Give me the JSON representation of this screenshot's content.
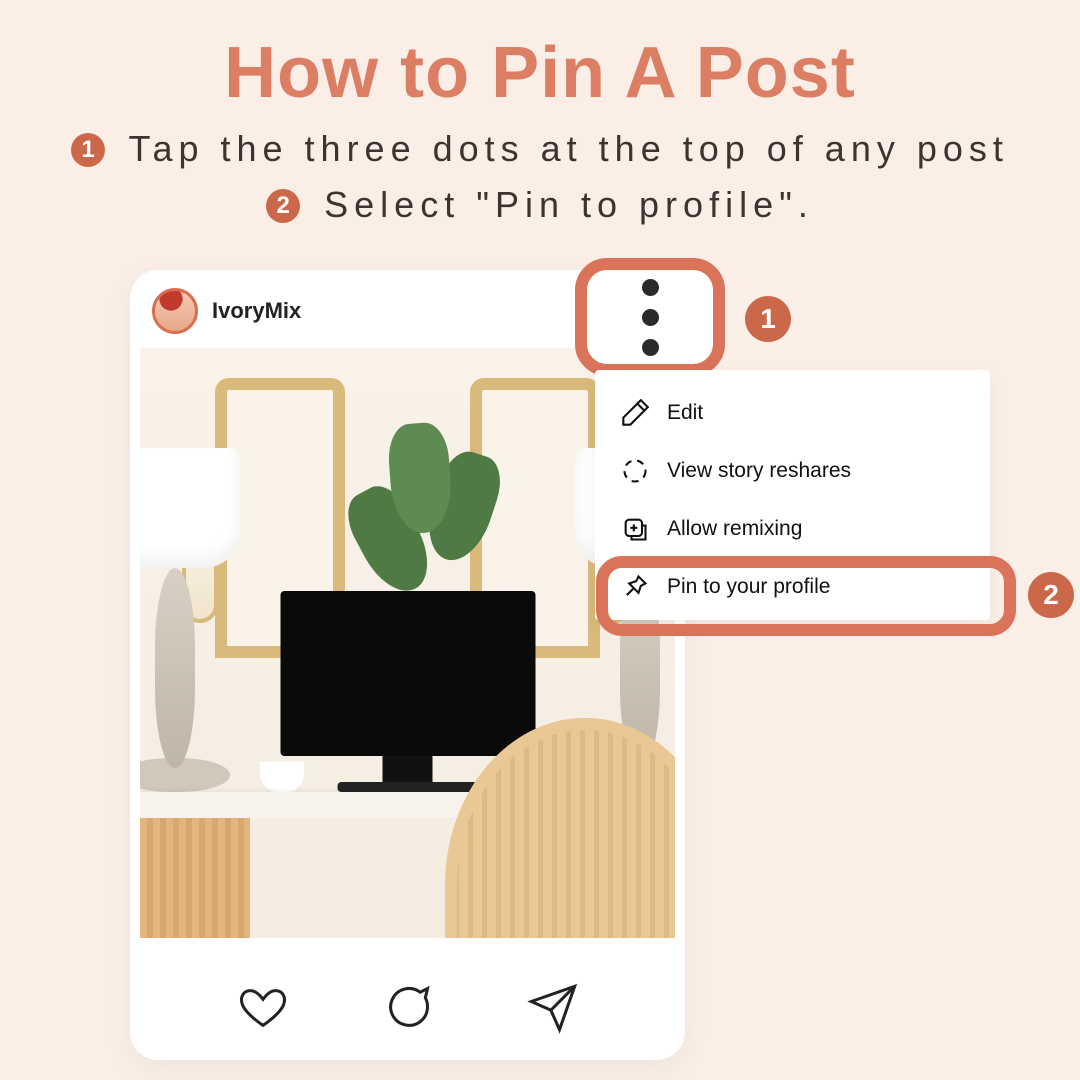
{
  "title": "How to Pin A Post",
  "steps": {
    "one_num": "1",
    "one_text": "Tap the three dots at the top of any post",
    "two_num": "2",
    "two_text": "Select \"Pin to profile\"."
  },
  "post": {
    "username": "IvoryMix"
  },
  "menu": {
    "edit": "Edit",
    "reshares": "View story reshares",
    "remixing": "Allow remixing",
    "pin": "Pin to your profile"
  },
  "callouts": {
    "c1": "1",
    "c2": "2"
  }
}
